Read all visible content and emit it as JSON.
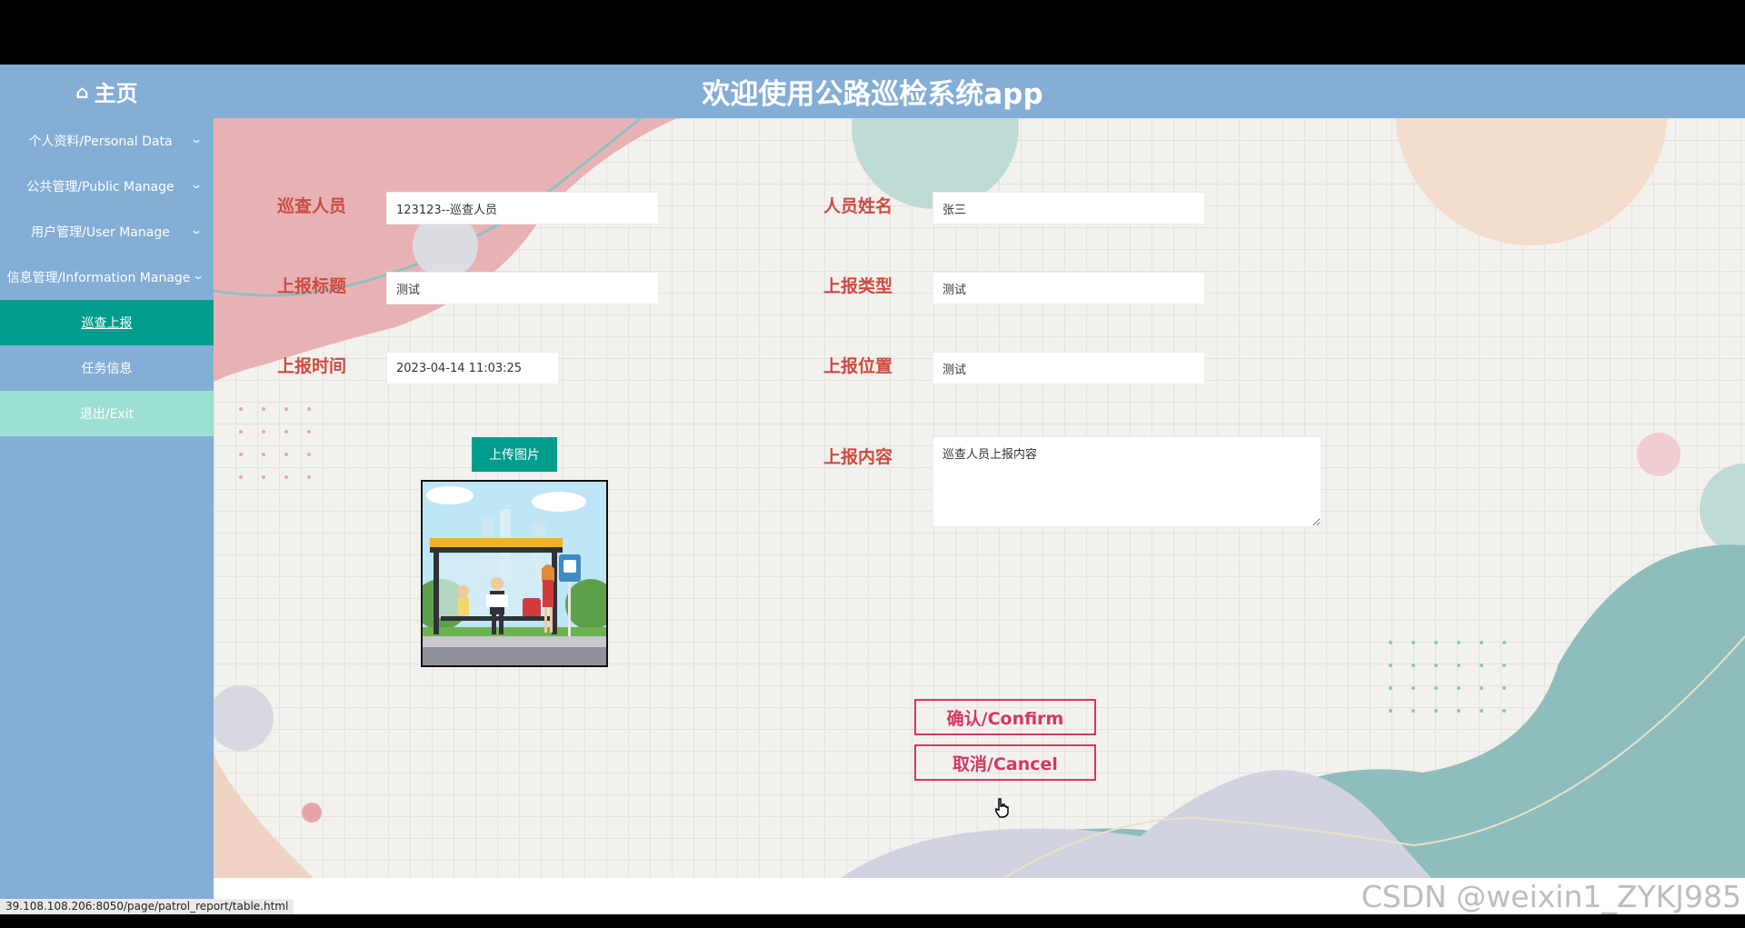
{
  "header": {
    "home_label": "主页",
    "app_title": "欢迎使用公路巡检系统app"
  },
  "sidebar": {
    "items": [
      {
        "label": "个人资料/Personal Data",
        "icon": "chevron-down-icon"
      },
      {
        "label": "公共管理/Public Manage",
        "icon": "chevron-down-icon"
      },
      {
        "label": "用户管理/User Manage",
        "icon": "chevron-down-icon"
      },
      {
        "label": "信息管理/Information Manage",
        "icon": "chevron-down-icon"
      },
      {
        "label": "巡查上报",
        "active": true
      },
      {
        "label": "任务信息"
      },
      {
        "label": "退出/Exit"
      }
    ]
  },
  "form": {
    "inspector_label": "巡查人员",
    "inspector_value": "123123--巡查人员",
    "name_label": "人员姓名",
    "name_value": "张三",
    "title_label": "上报标题",
    "title_value": "测试",
    "type_label": "上报类型",
    "type_value": "测试",
    "time_label": "上报时间",
    "time_value": "2023-04-14 11:03:25",
    "location_label": "上报位置",
    "location_value": "测试",
    "content_label": "上报内容",
    "content_value": "巡查人员上报内容",
    "upload_label": "上传图片",
    "confirm_label": "确认/Confirm",
    "cancel_label": "取消/Cancel"
  },
  "status_bar": {
    "url": "39.108.108.206:8050/page/patrol_report/table.html"
  },
  "watermark": "CSDN @weixin1_ZYKJ985",
  "colors": {
    "header_bg": "#84aed6",
    "active_item": "#009c8c",
    "exit_item": "#9de0d2",
    "label_red": "#cf4a40",
    "button_pink": "#d33860"
  }
}
